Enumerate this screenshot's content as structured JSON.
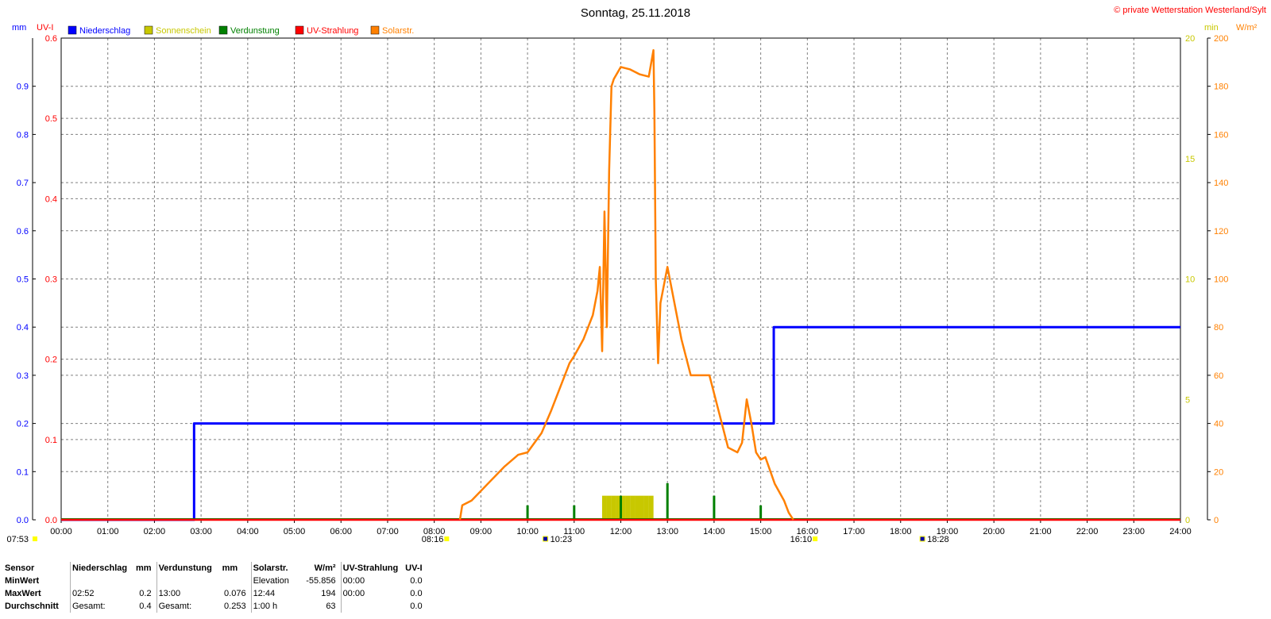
{
  "chart_data": {
    "type": "line",
    "title": "Sonntag, 25.11.2018",
    "copyright": "© private Wetterstation Westerland/Sylt",
    "left_axes": [
      {
        "unit": "mm",
        "color": "#0000ff",
        "ylim": [
          0,
          1.0
        ],
        "ticks": [
          "0.0",
          "0.1",
          "0.2",
          "0.3",
          "0.4",
          "0.5",
          "0.6",
          "0.7",
          "0.8",
          "0.9"
        ]
      },
      {
        "unit": "UV-I",
        "color": "#ff0000",
        "ylim": [
          0,
          0.6
        ],
        "ticks": [
          "0.0",
          "0.1",
          "0.2",
          "0.3",
          "0.4",
          "0.5",
          "0.6"
        ]
      }
    ],
    "right_axes": [
      {
        "unit": "min",
        "color": "#c8c800",
        "ylim": [
          0,
          20
        ],
        "ticks": [
          "0",
          "5",
          "10",
          "15",
          "20"
        ]
      },
      {
        "unit": "W/m²",
        "color": "#ff8000",
        "ylim": [
          0,
          200
        ],
        "ticks": [
          "0",
          "20",
          "40",
          "60",
          "80",
          "100",
          "120",
          "140",
          "160",
          "180",
          "200"
        ]
      }
    ],
    "x_ticks": [
      "00:00",
      "01:00",
      "02:00",
      "03:00",
      "04:00",
      "05:00",
      "06:00",
      "07:00",
      "08:00",
      "09:00",
      "10:00",
      "11:00",
      "12:00",
      "13:00",
      "14:00",
      "15:00",
      "16:00",
      "17:00",
      "18:00",
      "19:00",
      "20:00",
      "21:00",
      "22:00",
      "23:00",
      "24:00"
    ],
    "xlim": [
      0,
      24
    ],
    "grid": true,
    "legend_position": "top-left",
    "series": [
      {
        "name": "Niederschlag",
        "color": "#0000ff",
        "axis": "mm",
        "kind": "step",
        "x": [
          0,
          2.85,
          2.85,
          15.28,
          15.28,
          24
        ],
        "y": [
          0,
          0,
          0.2,
          0.2,
          0.4,
          0.4
        ]
      },
      {
        "name": "Sonnenschein",
        "color": "#c8c800",
        "axis": "min",
        "kind": "bars",
        "x": [
          11.65,
          11.75,
          11.85,
          11.95,
          12.05,
          12.15,
          12.25,
          12.35,
          12.45,
          12.55,
          12.65
        ],
        "y": [
          1,
          1,
          1,
          1,
          1,
          1,
          1,
          1,
          1,
          1,
          1
        ]
      },
      {
        "name": "Verdunstung",
        "color": "#008000",
        "axis": "mm",
        "kind": "bars",
        "x": [
          10.0,
          11.0,
          12.0,
          13.0,
          14.0,
          15.0
        ],
        "y": [
          0.03,
          0.03,
          0.05,
          0.076,
          0.05,
          0.03
        ]
      },
      {
        "name": "UV-Strahlung",
        "color": "#ff0000",
        "axis": "UV-I",
        "kind": "line",
        "x": [
          0,
          24
        ],
        "y": [
          0,
          0
        ]
      },
      {
        "name": "Solarstr.",
        "color": "#ff8000",
        "axis": "W/m²",
        "kind": "line",
        "x": [
          8.55,
          8.6,
          8.8,
          9.0,
          9.2,
          9.5,
          9.8,
          10.0,
          10.3,
          10.5,
          10.7,
          10.9,
          11.0,
          11.2,
          11.4,
          11.5,
          11.55,
          11.6,
          11.65,
          11.7,
          11.75,
          11.8,
          11.85,
          12.0,
          12.2,
          12.4,
          12.6,
          12.7,
          12.72,
          12.75,
          12.8,
          12.85,
          12.9,
          13.0,
          13.1,
          13.3,
          13.5,
          13.6,
          13.9,
          14.1,
          14.3,
          14.5,
          14.6,
          14.7,
          14.8,
          14.9,
          15.0,
          15.1,
          15.3,
          15.5,
          15.6,
          15.7
        ],
        "y": [
          0,
          6,
          8,
          12,
          16,
          22,
          27,
          28,
          36,
          45,
          55,
          65,
          68,
          75,
          85,
          95,
          105,
          70,
          128,
          80,
          145,
          180,
          183,
          188,
          187,
          185,
          184,
          195,
          170,
          100,
          65,
          90,
          95,
          105,
          95,
          75,
          60,
          60,
          60,
          45,
          30,
          28,
          32,
          50,
          40,
          28,
          25,
          26,
          15,
          8,
          3,
          0
        ]
      }
    ],
    "markers": [
      {
        "label": "07:53",
        "kind": "sunrise"
      },
      {
        "label": "08:16",
        "kind": "sunrise"
      },
      {
        "label": "10:23",
        "kind": "solar"
      },
      {
        "label": "16:10",
        "kind": "sunset"
      },
      {
        "label": "18:28",
        "kind": "solar"
      }
    ]
  },
  "summary": {
    "headers": [
      "Sensor",
      "Niederschlag",
      "mm",
      "Verdunstung",
      "mm",
      "Solarstr.",
      "W/m²",
      "UV-Strahlung",
      "UV-I"
    ],
    "rows": [
      {
        "label": "MinWert",
        "cells": [
          "",
          "",
          "",
          "",
          "Elevation",
          "-55.856",
          "00:00",
          "0.0"
        ]
      },
      {
        "label": "MaxWert",
        "cells": [
          "02:52",
          "0.2",
          "13:00",
          "0.076",
          "12:44",
          "194",
          "00:00",
          "0.0"
        ]
      },
      {
        "label": "Durchschnitt",
        "cells": [
          "Gesamt:",
          "0.4",
          "Gesamt:",
          "0.253",
          "1:00 h",
          "63",
          "",
          "0.0"
        ]
      }
    ]
  }
}
